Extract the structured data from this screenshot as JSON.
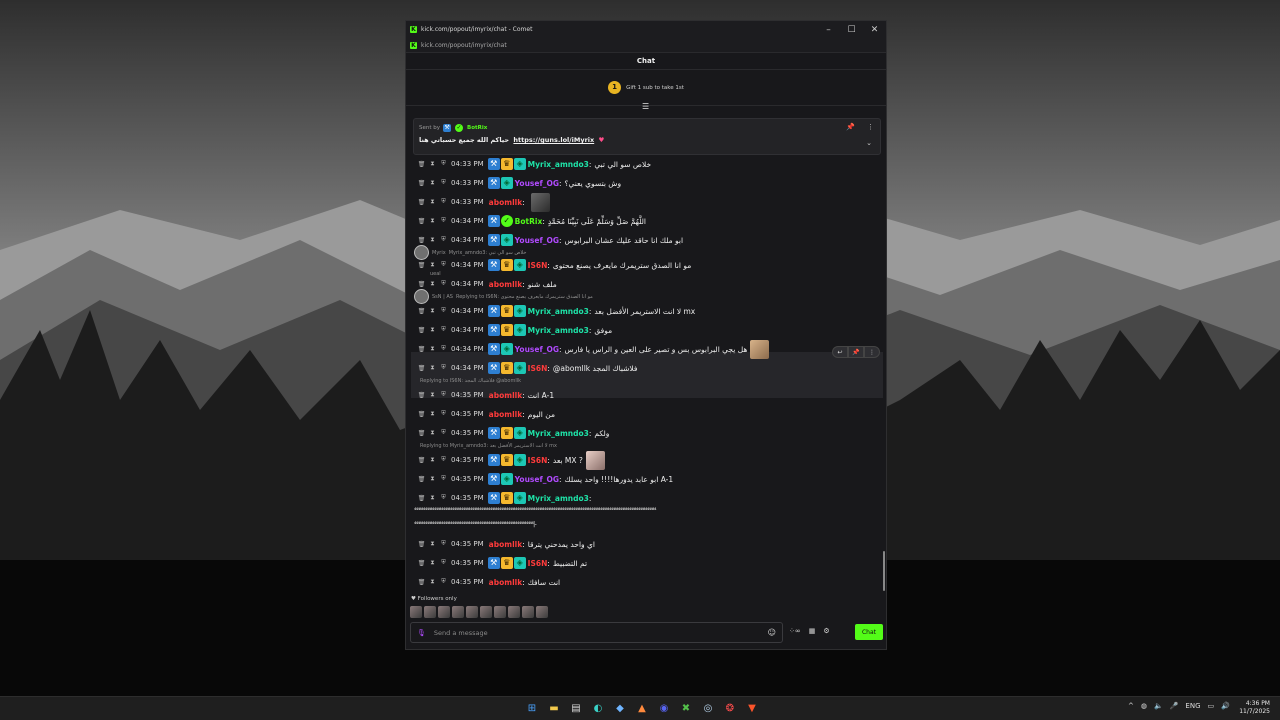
{
  "window": {
    "title": "kick.com/popout/imyrix/chat - Comet",
    "url": "kick.com/popout/imyrix/chat",
    "minimize": "–",
    "maximize": "☐",
    "close": "✕"
  },
  "chat": {
    "header": "Chat",
    "gift": {
      "count": "1",
      "text": "Gift 1 sub to take 1st"
    },
    "pinned": {
      "sent_by": "Sent by",
      "author": "BotRix",
      "message_prefix": "حياكم الله جميع حسباتي هنا",
      "link": "https://guns.lol/iMyrix",
      "heart": "♥"
    },
    "messages": [
      {
        "time": "04:33 PM",
        "user": "Myrix_amndo3",
        "text": "خلاص سو الي تبي"
      },
      {
        "time": "04:33 PM",
        "user": "Yousef_OG",
        "text": "وش بتسوي يعني؟"
      },
      {
        "time": "04:33 PM",
        "user": "abomllk",
        "text": ""
      },
      {
        "time": "04:34 PM",
        "user": "BotRix",
        "text": "اللَّهُمَّ صَلِّ وَسَلِّمْ عَلَى نَبِيِّنَا مُحَمَّدٍ"
      },
      {
        "time": "04:34 PM",
        "user": "Yousef_OG",
        "text": "ابو ملك انا حاقد عليك عشان البرابوس"
      },
      {
        "time": "04:34 PM",
        "user": "IS6N",
        "text": "مو انا الصدق ستريمرك مايعرف يصنع محتوى"
      },
      {
        "time": "04:34 PM",
        "user": "abomllk",
        "text": "ملف شنو"
      },
      {
        "time": "04:34 PM",
        "user": "Myrix_amndo3",
        "text": "لا انت الاستريمر الأفضل بعد mx"
      },
      {
        "time": "04:34 PM",
        "user": "Myrix_amndo3",
        "text": "موفق"
      },
      {
        "time": "04:34 PM",
        "user": "Yousef_OG",
        "text": "هل يجي البرابوس بس و تصير على العين و الراس يا فارس"
      },
      {
        "time": "04:34 PM",
        "user": "IS6N",
        "text": "@abomllk فلاشباك المجد"
      },
      {
        "time": "04:35 PM",
        "user": "abomllk",
        "text": "انت A-1"
      },
      {
        "time": "04:35 PM",
        "user": "abomllk",
        "text": "من اليوم"
      },
      {
        "time": "04:35 PM",
        "user": "Myrix_amndo3",
        "text": "ولكم"
      },
      {
        "time": "04:35 PM",
        "user": "IS6N",
        "text": "بعد MX ?"
      },
      {
        "time": "04:35 PM",
        "user": "Yousef_OG",
        "text": "ابو عابد يدورها!!!! واحد يسلك A-1"
      },
      {
        "time": "04:35 PM",
        "user": "Myrix_amndo3",
        "text": ""
      },
      {
        "time": "04:35 PM",
        "user": "abomllk",
        "text": "اي واحد يمدحني يترقا"
      },
      {
        "time": "04:35 PM",
        "user": "IS6N",
        "text": "تم التضبيط"
      },
      {
        "time": "04:35 PM",
        "user": "abomllk",
        "text": "انت سافك"
      }
    ],
    "replies": {
      "r1": "Replying to IS6N: فلاشباك المجد @abomllk",
      "r2": "Replying to Myrix_amndo3: لا انت الاستريمر الأفضل بعد mx"
    },
    "notifications": {
      "n1_user": "Myrix",
      "n1_text": "Myrix_amndo3: خلاص سو الي تبي",
      "n1_sub": "ueal",
      "n2_user": "SsN | AS",
      "n2_text": "Replying to IS6N: مو انا الصدق ستريمرك مايعرف يصنع محتوى"
    },
    "long_message_line1": "⁴⁴⁴⁴⁴⁴⁴⁴⁴⁴⁴⁴⁴⁴⁴⁴⁴⁴⁴⁴⁴⁴⁴⁴⁴⁴⁴⁴⁴⁴⁴⁴⁴⁴⁴⁴⁴⁴⁴⁴⁴⁴⁴⁴⁴⁴⁴⁴⁴⁴⁴⁴⁴⁴⁴⁴⁴⁴⁴⁴⁴⁴⁴⁴⁴⁴⁴⁴⁴⁴⁴⁴⁴⁴⁴⁴⁴⁴⁴⁴⁴⁴⁴⁴⁴⁴⁴⁴⁴⁴⁴⁴⁴⁴⁴⁴⁴⁴⁴⁴⁴⁴⁴⁴⁴⁴⁴⁴⁴⁴⁴⁴⁴⁴⁴⁴⁴⁴⁴⁴⁴⁴⁴⁴⁴⁴⁴⁴⁴⁴⁴⁴⁴⁴",
    "long_message_line2": "⁴⁴⁴⁴⁴⁴⁴⁴⁴⁴⁴⁴⁴⁴⁴⁴⁴⁴⁴⁴⁴⁴⁴⁴⁴⁴⁴⁴⁴⁴⁴⁴⁴⁴⁴⁴⁴⁴⁴⁴⁴⁴⁴⁴⁴⁴⁴⁴⁴⁴⁴⁴⁴⁴⁴⁴⁴⁴⁴⁴⁴⁴⁴⁴⁴⁴|-",
    "followers_only": "♥ Followers only",
    "input_placeholder": "Send a message",
    "send_label": "Chat"
  },
  "taskbar": {
    "language": "ENG",
    "time": "4:36 PM",
    "date": "11/7/2025"
  },
  "colors": {
    "kick_green": "#53fc18",
    "user_green": "#1ee3a8",
    "user_purple": "#b14bff",
    "user_red": "#ff3b3b"
  }
}
